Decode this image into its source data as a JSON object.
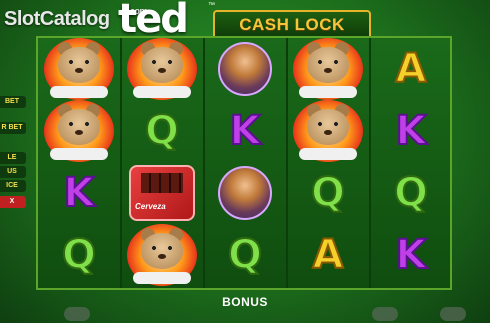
{
  "watermark": {
    "name": "SlotCatalog",
    "tld": ".com"
  },
  "game": {
    "title": "ted",
    "trademark": "™",
    "subtitle": "CASH LOCK"
  },
  "side": {
    "labels": [
      "BET",
      "R BET",
      "LE",
      "US",
      "ICE",
      "X"
    ]
  },
  "reels": [
    [
      "bear",
      "bear",
      "K",
      "Q"
    ],
    [
      "bear",
      "Q",
      "beer",
      "bear"
    ],
    [
      "lady",
      "K",
      "lady",
      "Q"
    ],
    [
      "bear",
      "bear",
      "Q",
      "A"
    ],
    [
      "A",
      "K",
      "Q",
      "K"
    ]
  ],
  "beer_brand": "Cerveza",
  "footer": {
    "bonus_label": "BONUS"
  },
  "colors": {
    "Q": "#7fe04a",
    "K": "#c040e8",
    "A": "#f5cf2a",
    "frame": "#5aa52a"
  }
}
